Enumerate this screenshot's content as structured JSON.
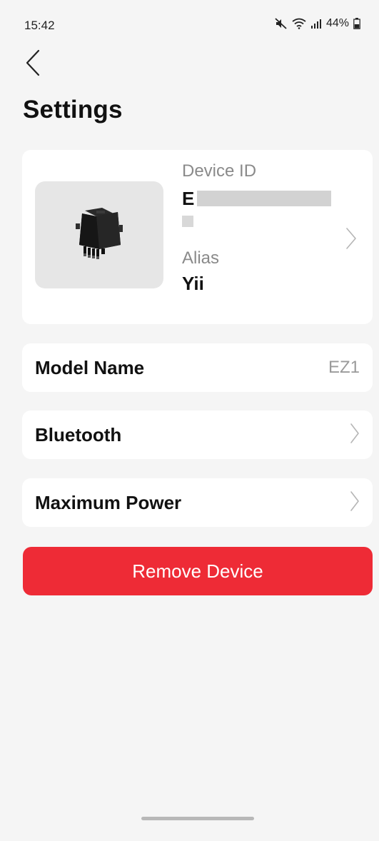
{
  "status_bar": {
    "time": "15:42",
    "battery": "44%",
    "icons": [
      "mute-icon",
      "wifi-icon",
      "signal-icon",
      "battery-icon"
    ]
  },
  "header": {
    "back_icon": "chevron-left-icon",
    "title": "Settings"
  },
  "device": {
    "image_icon": "microinverter-icon",
    "id_label": "Device ID",
    "id_value_visible": "E",
    "alias_label": "Alias",
    "alias_value": "Yii"
  },
  "rows": {
    "model_name_label": "Model Name",
    "model_name_value": "EZ1",
    "bluetooth_label": "Bluetooth",
    "maximum_power_label": "Maximum Power"
  },
  "actions": {
    "remove_label": "Remove Device",
    "remove_color": "#ee2b36"
  }
}
